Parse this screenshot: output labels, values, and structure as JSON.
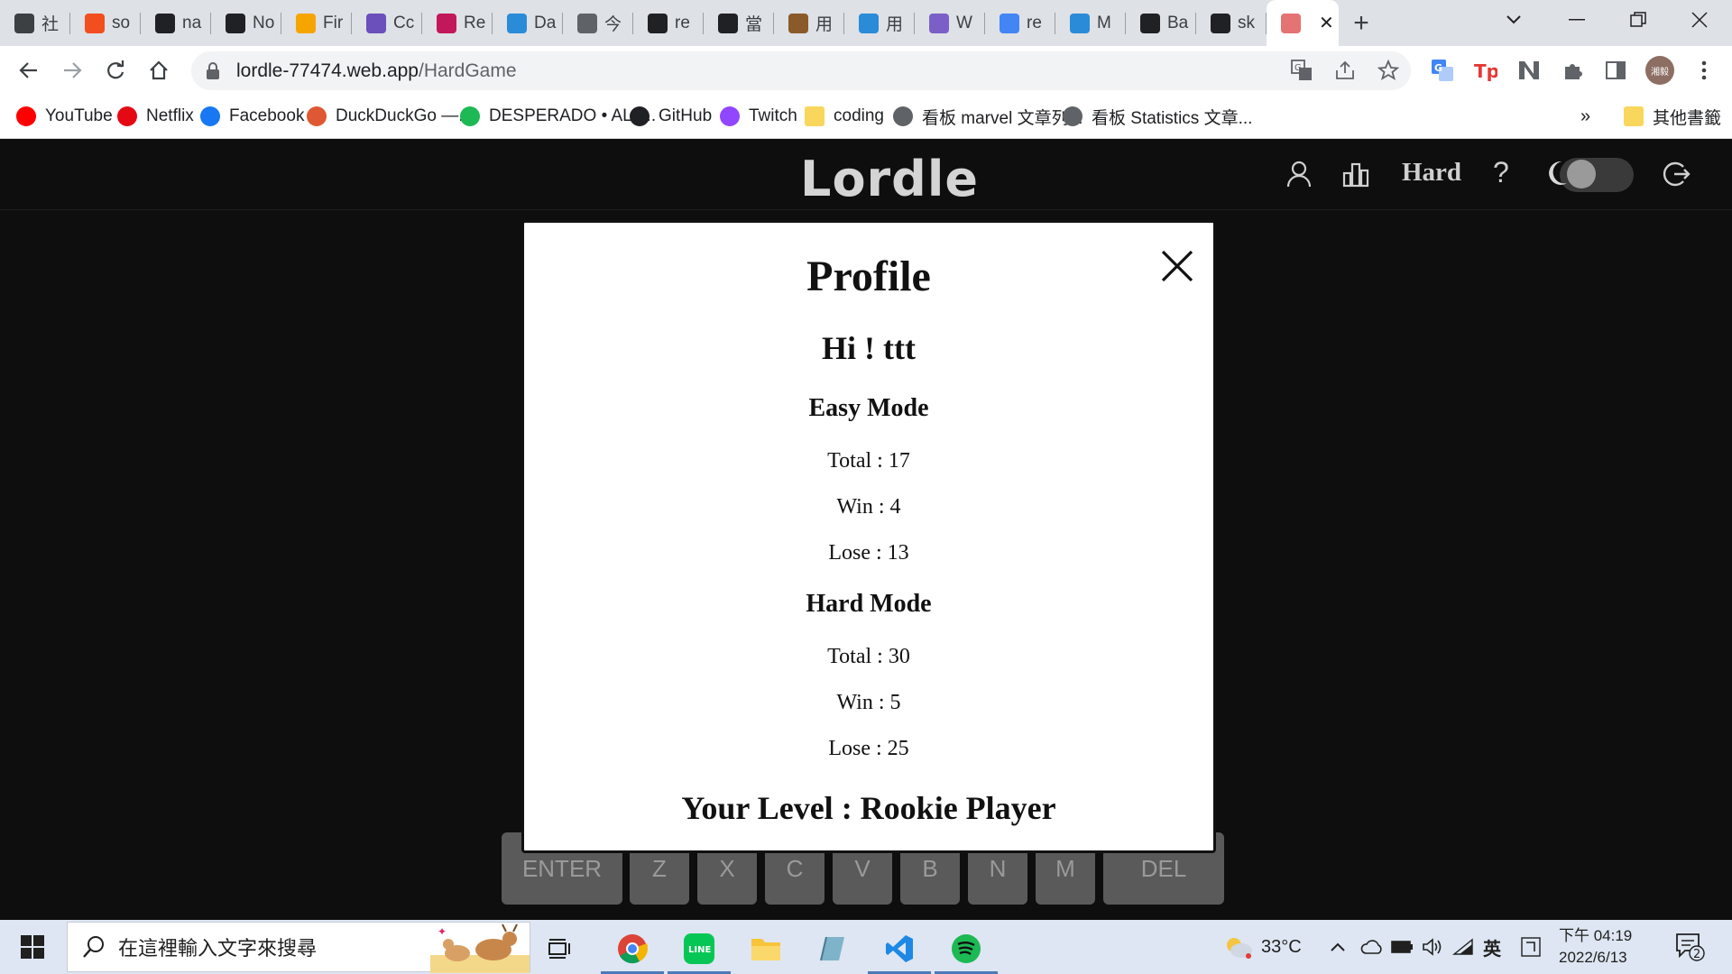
{
  "browser": {
    "tabs": [
      {
        "label": "社",
        "icon": "feather-icon",
        "color": "#3c4043"
      },
      {
        "label": "so",
        "icon": "figma-icon",
        "color": "#f24e1e"
      },
      {
        "label": "na",
        "icon": "github-icon",
        "color": "#202124"
      },
      {
        "label": "No",
        "icon": "notion-icon",
        "color": "#202124"
      },
      {
        "label": "Fir",
        "icon": "firebase-icon",
        "color": "#f6a500"
      },
      {
        "label": "Cc",
        "icon": "rocket-icon",
        "color": "#6b4fbb"
      },
      {
        "label": "Re",
        "icon": "dots-icon",
        "color": "#c2185b"
      },
      {
        "label": "Da",
        "icon": "site-icon",
        "color": "#2a8bd8"
      },
      {
        "label": "今",
        "icon": "globe-icon",
        "color": "#5f6368"
      },
      {
        "label": "re",
        "icon": "github-icon",
        "color": "#202124"
      },
      {
        "label": "當",
        "icon": "tb-icon",
        "color": "#202124"
      },
      {
        "label": "用",
        "icon": "book-icon",
        "color": "#8a5a2b"
      },
      {
        "label": "用",
        "icon": "site-icon",
        "color": "#2a8bd8"
      },
      {
        "label": "W",
        "icon": "web-icon",
        "color": "#7b5fc7"
      },
      {
        "label": "re",
        "icon": "google-icon",
        "color": "#4285f4"
      },
      {
        "label": "M",
        "icon": "site-icon",
        "color": "#2a8bd8"
      },
      {
        "label": "Ba",
        "icon": "github-icon",
        "color": "#202124"
      },
      {
        "label": "sk",
        "icon": "github-icon",
        "color": "#202124"
      },
      {
        "label": "",
        "icon": "brain-icon",
        "color": "#e57373"
      }
    ],
    "url_host": "lordle-77474.web.app",
    "url_path": "/HardGame",
    "bookmarks": [
      {
        "label": "YouTube",
        "icon": "youtube-icon",
        "color": "#ff0000"
      },
      {
        "label": "Netflix",
        "icon": "netflix-icon",
        "color": "#e50914"
      },
      {
        "label": "Facebook",
        "icon": "facebook-icon",
        "color": "#1877f2"
      },
      {
        "label": "DuckDuckGo —...",
        "icon": "duckduckgo-icon",
        "color": "#de5833"
      },
      {
        "label": "DESPERADO • ALI,...",
        "icon": "spotify-icon",
        "color": "#1db954"
      },
      {
        "label": "GitHub",
        "icon": "github-icon",
        "color": "#202124"
      },
      {
        "label": "Twitch",
        "icon": "twitch-icon",
        "color": "#9146ff"
      },
      {
        "label": "coding",
        "icon": "folder-icon",
        "color": "#f9d65c"
      },
      {
        "label": "看板 marvel 文章列...",
        "icon": "globe-icon",
        "color": "#5f6368"
      },
      {
        "label": "看板 Statistics 文章...",
        "icon": "globe-icon",
        "color": "#5f6368"
      }
    ],
    "more_bookmarks": "»",
    "other_bookmarks": "其他書籤",
    "profile_initials": "湘毅"
  },
  "app": {
    "logo": "Lordle",
    "mode": "Hard",
    "help": "?",
    "keyboard_row": [
      "ENTER",
      "Z",
      "X",
      "C",
      "V",
      "B",
      "N",
      "M",
      "DEL"
    ]
  },
  "modal": {
    "title": "Profile",
    "greeting": "Hi ! ttt",
    "easy": {
      "heading": "Easy Mode",
      "total": "Total : 17",
      "win": "Win : 4",
      "lose": "Lose : 13"
    },
    "hard": {
      "heading": "Hard Mode",
      "total": "Total : 30",
      "win": "Win : 5",
      "lose": "Lose : 25"
    },
    "level": "Your Level : Rookie Player"
  },
  "taskbar": {
    "search_placeholder": "在這裡輸入文字來搜尋",
    "weather": "33°C",
    "ime": "英",
    "time": "下午 04:19",
    "date": "2022/6/13",
    "notifications": "2"
  }
}
